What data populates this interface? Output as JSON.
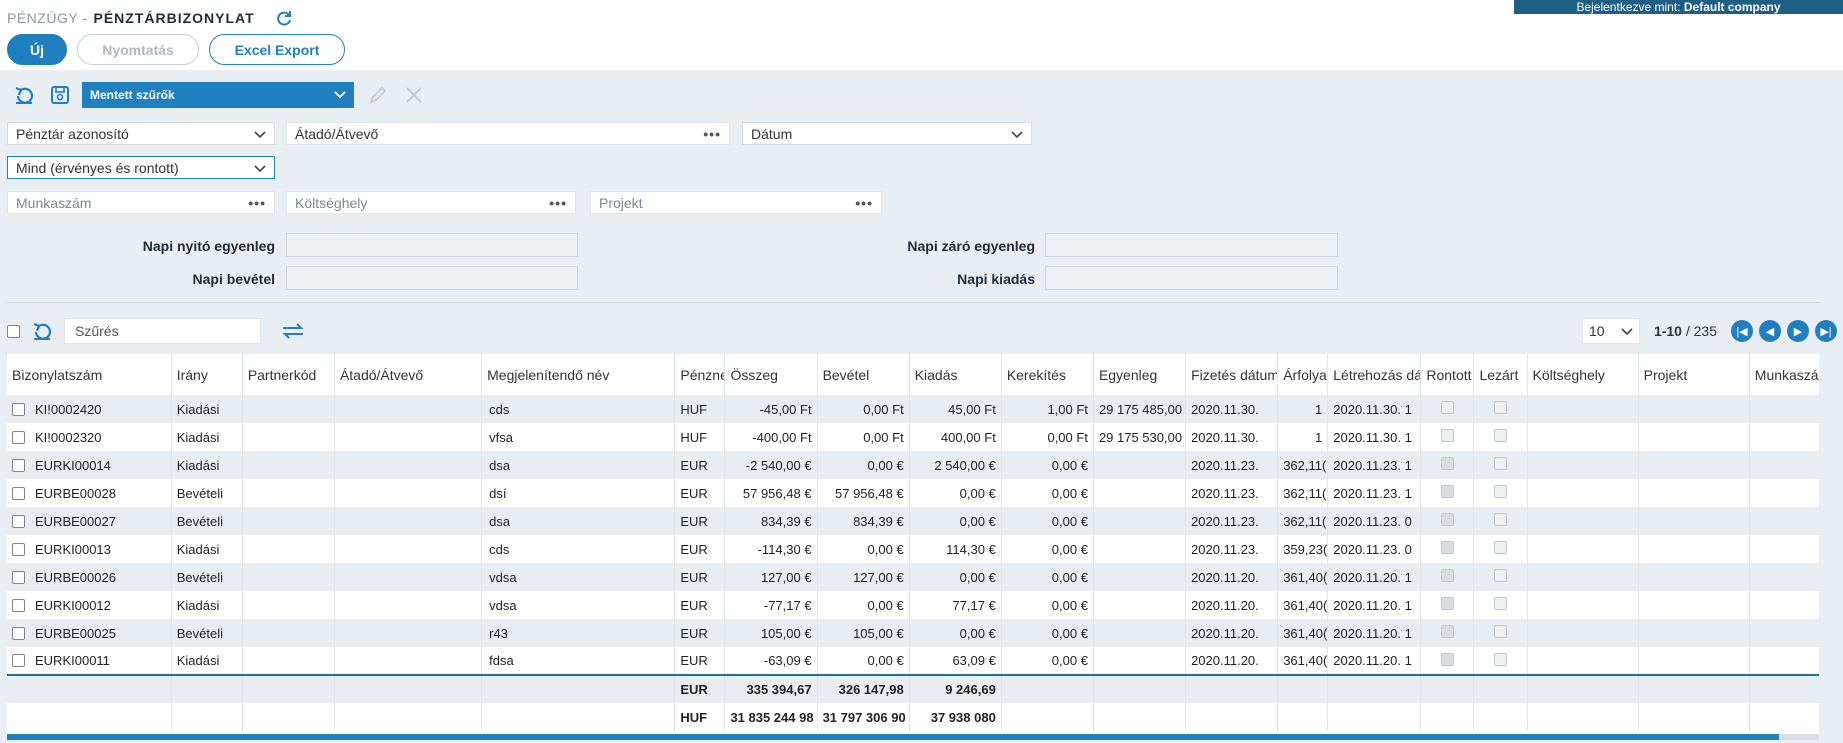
{
  "header": {
    "module": "PÉNZÜGY -",
    "page_title": "PÉNZTÁRBIZONYLAT",
    "login_prefix": "Bejelentkezve mint:",
    "login_company": "Default company"
  },
  "actions": {
    "new_label": "Új",
    "print_label": "Nyomtatás",
    "excel_label": "Excel Export"
  },
  "filters": {
    "saved_filters": "Mentett szűrők",
    "cashbox": "Pénztár azonosító",
    "giver_receiver": "Átadó/Átvevő",
    "date": "Dátum",
    "validity": "Mind (érvényes és rontott)",
    "work_number": "Munkaszám",
    "cost_center": "Költséghely",
    "project": "Projekt"
  },
  "summary": {
    "opening_label": "Napi nyitó egyenleg",
    "income_label": "Napi bevétel",
    "closing_label": "Napi záró egyenleg",
    "expense_label": "Napi kiadás"
  },
  "grid": {
    "search_placeholder": "Szűrés",
    "page_size": "10",
    "range": "1-10",
    "total": "/ 235",
    "columns": [
      "Bizonylatszám",
      "Irány",
      "Partnerkód",
      "Átadó/Átvevő",
      "Megjelenítendő név",
      "Pénznem",
      "Összeg",
      "Bevétel",
      "Kiadás",
      "Kerekítés",
      "Egyenleg",
      "Fizetés dátuma",
      "Árfolyam",
      "Létrehozás dátuma",
      "Rontott",
      "Lezárt",
      "Költséghely",
      "Projekt",
      "Munkaszám"
    ],
    "rows": [
      {
        "num": "KI!0002420",
        "dir": "Kiadási",
        "name": "cds",
        "cur": "HUF",
        "amount": "-45,00 Ft",
        "income": "0,00 Ft",
        "expense": "45,00 Ft",
        "round": "1,00 Ft",
        "balance": "29 175 485,00",
        "paydate": "2020.11.30.",
        "rate": "1",
        "created": "2020.11.30. 1",
        "voided": false
      },
      {
        "num": "KI!0002320",
        "dir": "Kiadási",
        "name": "vfsa",
        "cur": "HUF",
        "amount": "-400,00 Ft",
        "income": "0,00 Ft",
        "expense": "400,00 Ft",
        "round": "0,00 Ft",
        "balance": "29 175 530,00",
        "paydate": "2020.11.30.",
        "rate": "1",
        "created": "2020.11.30. 1",
        "voided": false
      },
      {
        "num": "EURKI00014",
        "dir": "Kiadási",
        "name": "dsa",
        "cur": "EUR",
        "amount": "-2 540,00 €",
        "income": "0,00 €",
        "expense": "2 540,00 €",
        "round": "0,00 €",
        "balance": "",
        "paydate": "2020.11.23.",
        "rate": "362,11(",
        "created": "2020.11.23. 1",
        "voided": true
      },
      {
        "num": "EURBE00028",
        "dir": "Bevételi",
        "name": "dsí",
        "cur": "EUR",
        "amount": "57 956,48 €",
        "income": "57 956,48 €",
        "expense": "0,00 €",
        "round": "0,00 €",
        "balance": "",
        "paydate": "2020.11.23.",
        "rate": "362,11(",
        "created": "2020.11.23. 1",
        "voided": true
      },
      {
        "num": "EURBE00027",
        "dir": "Bevételi",
        "name": "dsa",
        "cur": "EUR",
        "amount": "834,39 €",
        "income": "834,39 €",
        "expense": "0,00 €",
        "round": "0,00 €",
        "balance": "",
        "paydate": "2020.11.23.",
        "rate": "362,11(",
        "created": "2020.11.23. 0",
        "voided": true
      },
      {
        "num": "EURKI00013",
        "dir": "Kiadási",
        "name": "cds",
        "cur": "EUR",
        "amount": "-114,30 €",
        "income": "0,00 €",
        "expense": "114,30 €",
        "round": "0,00 €",
        "balance": "",
        "paydate": "2020.11.23.",
        "rate": "359,23(",
        "created": "2020.11.23. 0",
        "voided": true
      },
      {
        "num": "EURBE00026",
        "dir": "Bevételi",
        "name": "vdsa",
        "cur": "EUR",
        "amount": "127,00 €",
        "income": "127,00 €",
        "expense": "0,00 €",
        "round": "0,00 €",
        "balance": "",
        "paydate": "2020.11.20.",
        "rate": "361,40(",
        "created": "2020.11.20. 1",
        "voided": true
      },
      {
        "num": "EURKI00012",
        "dir": "Kiadási",
        "name": "vdsa",
        "cur": "EUR",
        "amount": "-77,17 €",
        "income": "0,00 €",
        "expense": "77,17 €",
        "round": "0,00 €",
        "balance": "",
        "paydate": "2020.11.20.",
        "rate": "361,40(",
        "created": "2020.11.20. 1",
        "voided": true
      },
      {
        "num": "EURBE00025",
        "dir": "Bevételi",
        "name": "r43",
        "cur": "EUR",
        "amount": "105,00 €",
        "income": "105,00 €",
        "expense": "0,00 €",
        "round": "0,00 €",
        "balance": "",
        "paydate": "2020.11.20.",
        "rate": "361,40(",
        "created": "2020.11.20. 1",
        "voided": true
      },
      {
        "num": "EURKI00011",
        "dir": "Kiadási",
        "name": "fdsa",
        "cur": "EUR",
        "amount": "-63,09 €",
        "income": "0,00 €",
        "expense": "63,09 €",
        "round": "0,00 €",
        "balance": "",
        "paydate": "2020.11.20.",
        "rate": "361,40(",
        "created": "2020.11.20. 1",
        "voided": true
      }
    ],
    "totals": [
      {
        "cur": "EUR",
        "amount": "335 394,67",
        "income": "326 147,98",
        "expense": "9 246,69"
      },
      {
        "cur": "HUF",
        "amount": "31 835 244 98",
        "income": "31 797 306 90",
        "expense": "37 938 080"
      }
    ]
  },
  "colors": {
    "accent": "#1f7fbf",
    "login_bar": "#1f5e85",
    "background": "#e9eef3",
    "row_alt": "#e8edf2"
  }
}
